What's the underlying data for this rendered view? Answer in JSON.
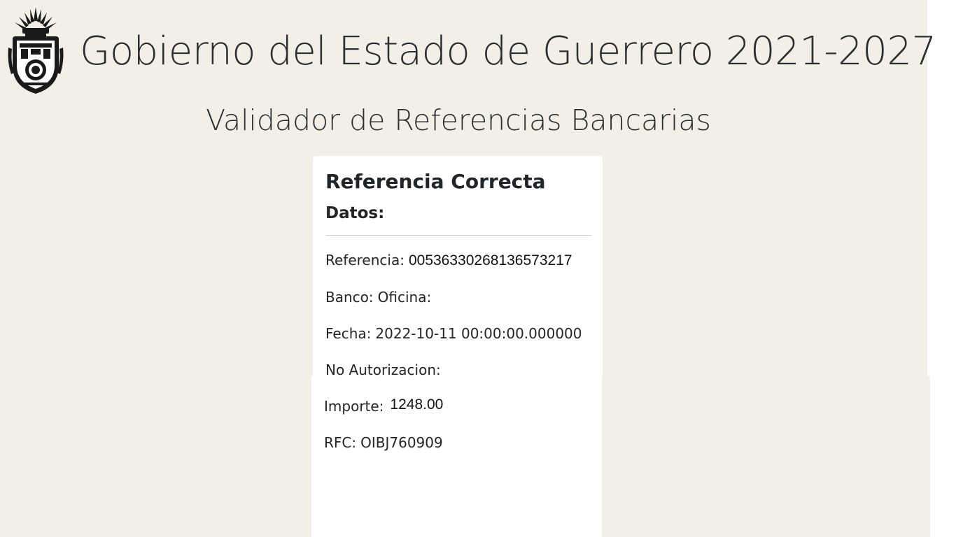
{
  "header": {
    "title": "Gobierno del Estado de Guerrero 2021-2027",
    "subtitle": "Validador de Referencias Bancarias",
    "logo_icon": "guerrero-state-seal-icon"
  },
  "card": {
    "title": "Referencia Correcta",
    "subtitle": "Datos:",
    "referencia_label": "Referencia:",
    "referencia_value": "00536330268136573217",
    "banco_label": "Banco:",
    "oficina_label": "Oficina:",
    "fecha_label": "Fecha:",
    "fecha_value": "2022-10-11 00:00:00.000000",
    "autorizacion_label": "No Autorizacion:",
    "importe_label": "Importe:",
    "importe_value": "1248.00",
    "rfc_label": "RFC:",
    "rfc_value": "OIBJ760909"
  },
  "colors": {
    "background": "#f2f0e6",
    "card": "#ffffff",
    "text": "#212529"
  }
}
